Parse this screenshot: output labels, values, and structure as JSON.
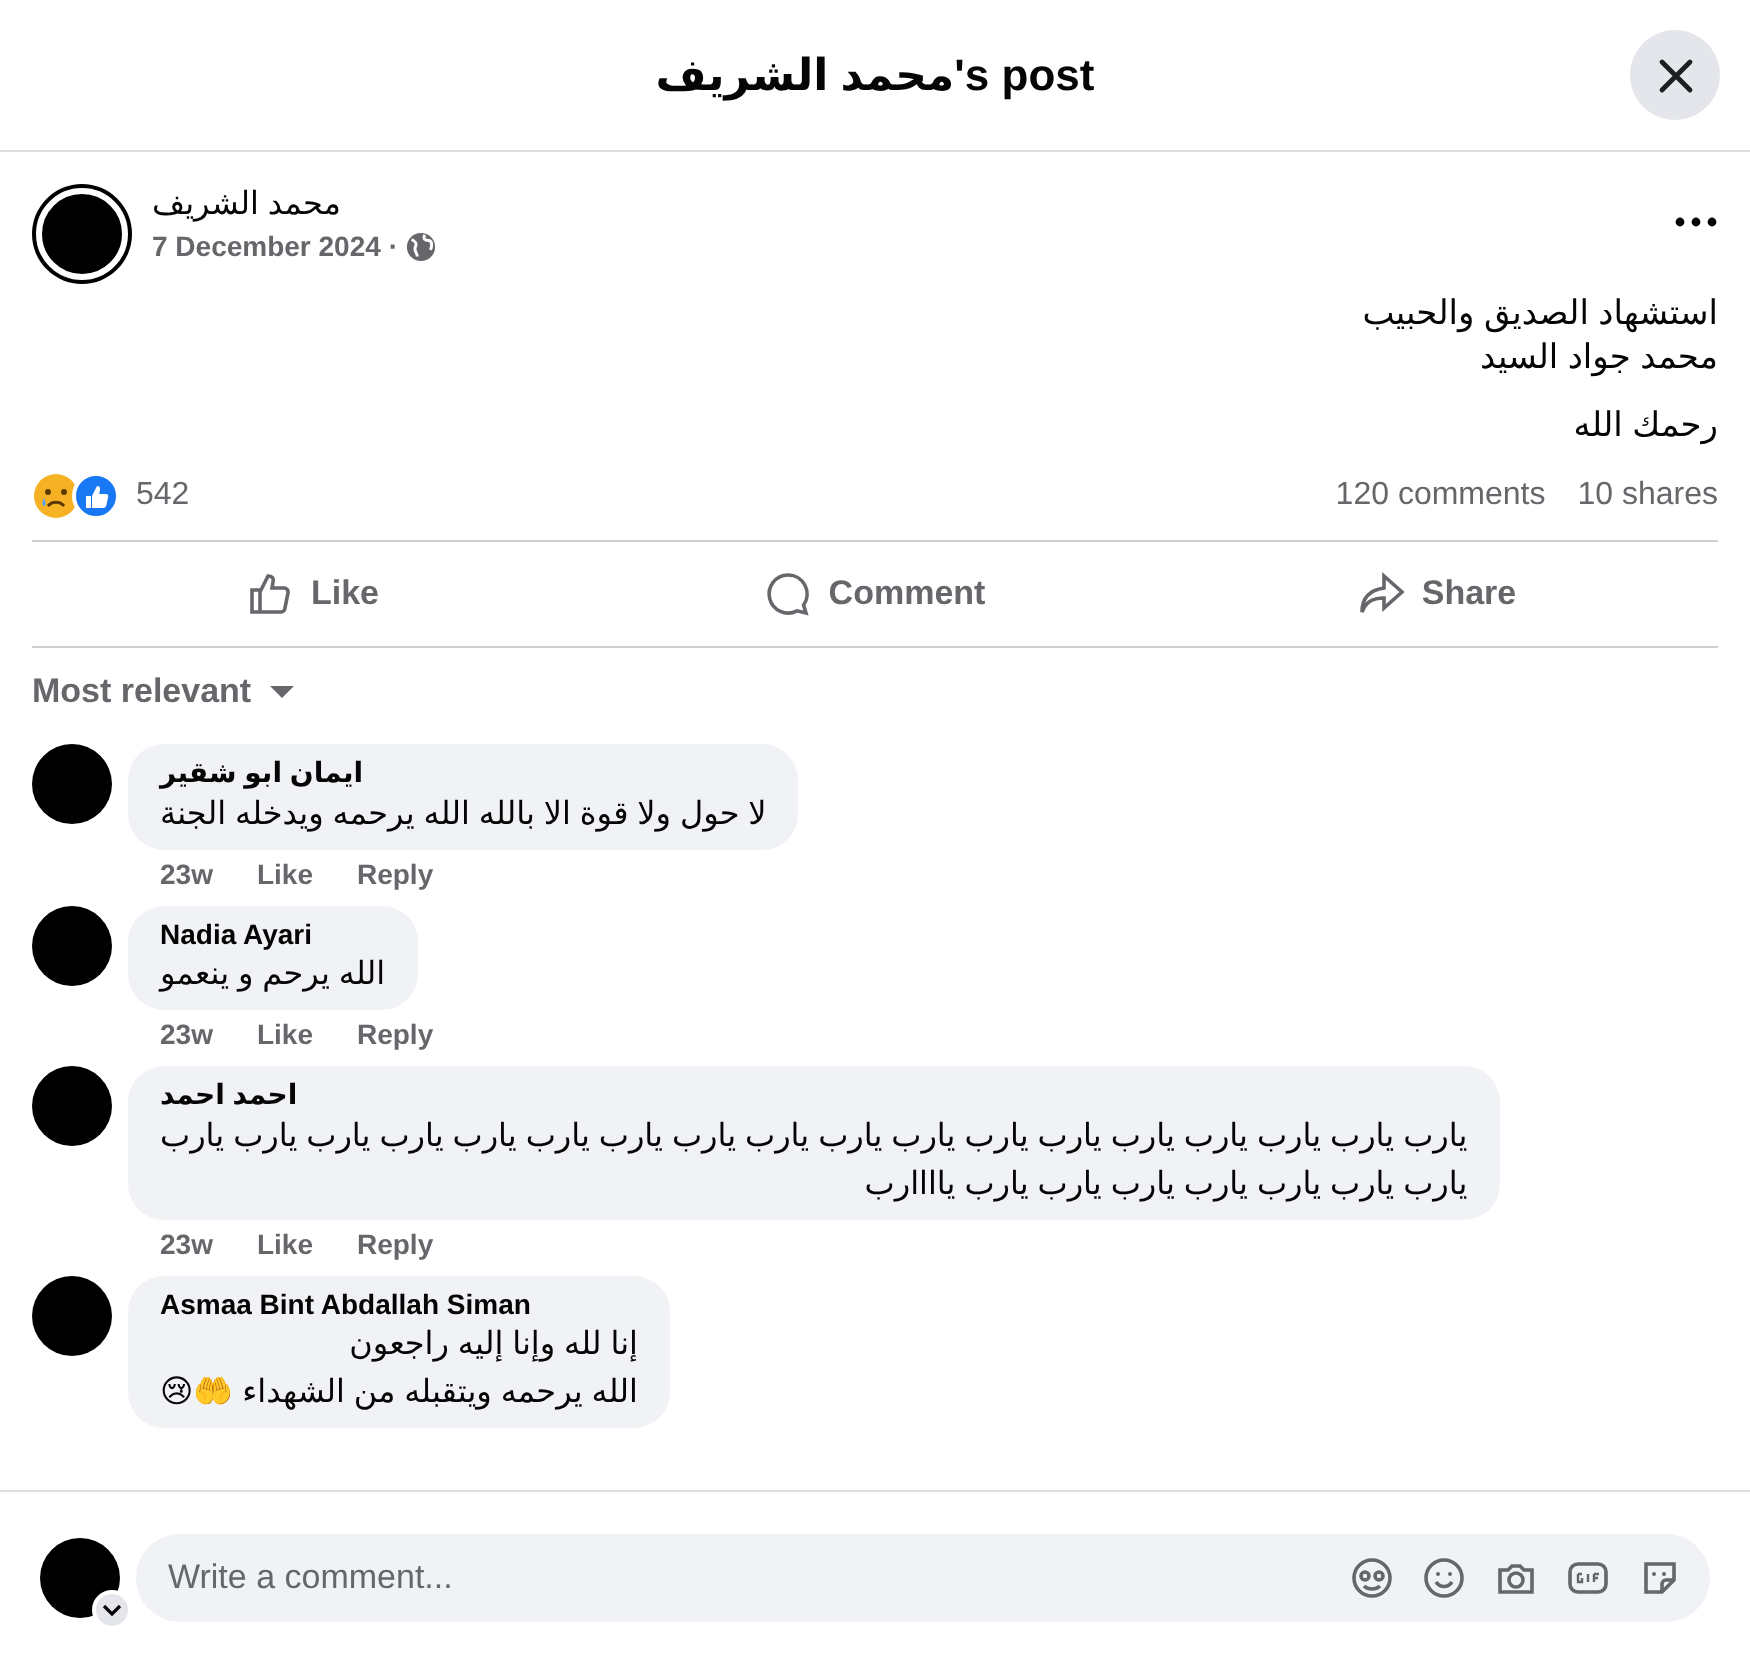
{
  "dialog": {
    "title": "محمد الشريف's post"
  },
  "post": {
    "author": "محمد الشريف",
    "date": "7 December 2024",
    "separator": "·",
    "lines": [
      "استشهاد الصديق والحبيب",
      "محمد جواد السيد",
      "رحمك الله"
    ],
    "reaction_count": "542",
    "comments_count": "120 comments",
    "shares_count": "10 shares"
  },
  "actions": {
    "like": {
      "label": "Like"
    },
    "comment": {
      "label": "Comment"
    },
    "share": {
      "label": "Share"
    }
  },
  "sort": {
    "label": "Most relevant"
  },
  "comments": [
    {
      "author": "ايمان ابو شقير",
      "lines": [
        "لا حول ولا قوة الا بالله الله يرحمه ويدخله الجنة"
      ],
      "time": "23w",
      "like": "Like",
      "reply": "Reply"
    },
    {
      "author": "Nadia Ayari",
      "lines": [
        "الله يرحم و ينعمو"
      ],
      "time": "23w",
      "like": "Like",
      "reply": "Reply"
    },
    {
      "author": "احمد احمد",
      "lines": [
        "يارب يارب يارب يارب يارب يارب يارب يارب يارب يارب يارب يارب يارب يارب يارب يارب يارب يارب",
        "يارب يارب يارب يارب يارب يارب يارب ياااارب"
      ],
      "time": "23w",
      "like": "Like",
      "reply": "Reply"
    },
    {
      "author": "Asmaa Bint Abdallah Siman",
      "lines": [
        "إنا لله وإنا إليه راجعون",
        "الله يرحمه ويتقبله من الشهداء 🤲😢"
      ]
    }
  ],
  "composer": {
    "placeholder": "Write a comment..."
  }
}
